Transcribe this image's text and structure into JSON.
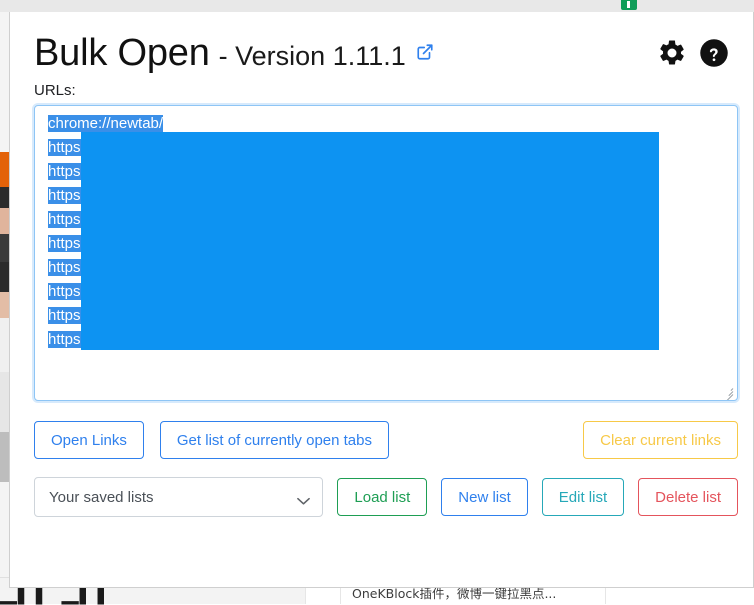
{
  "background": {
    "chart_glyph": "▁▍▍ ▁▍▍",
    "cn_snippet": "OneKBlock插件，微博一键拉黑点...",
    "badge_icon": "extension-badge"
  },
  "header": {
    "title": "Bulk Open",
    "version_text": "- Version 1.11.1",
    "external_link_icon": "external-link-icon",
    "settings_icon": "gear-icon",
    "help_icon": "question-mark-icon",
    "accent_blue": "#2f80ed"
  },
  "form": {
    "urls_label": "URLs:",
    "textarea_lines": [
      "chrome://newtab/",
      "https:",
      "https:",
      "https:",
      "https:",
      "https:",
      "https:",
      "https:",
      "https:",
      "https:"
    ],
    "selection_color": "#3a8fe8",
    "overlay_color": "#0d93f2"
  },
  "actions": {
    "open_links": "Open Links",
    "get_open_tabs": "Get list of currently open tabs",
    "clear_current_links": "Clear current links"
  },
  "lists": {
    "select_value": "Your saved lists",
    "select_options": [
      "Your saved lists"
    ],
    "load_list": "Load list",
    "new_list": "New list",
    "edit_list": "Edit list",
    "delete_list": "Delete list"
  }
}
